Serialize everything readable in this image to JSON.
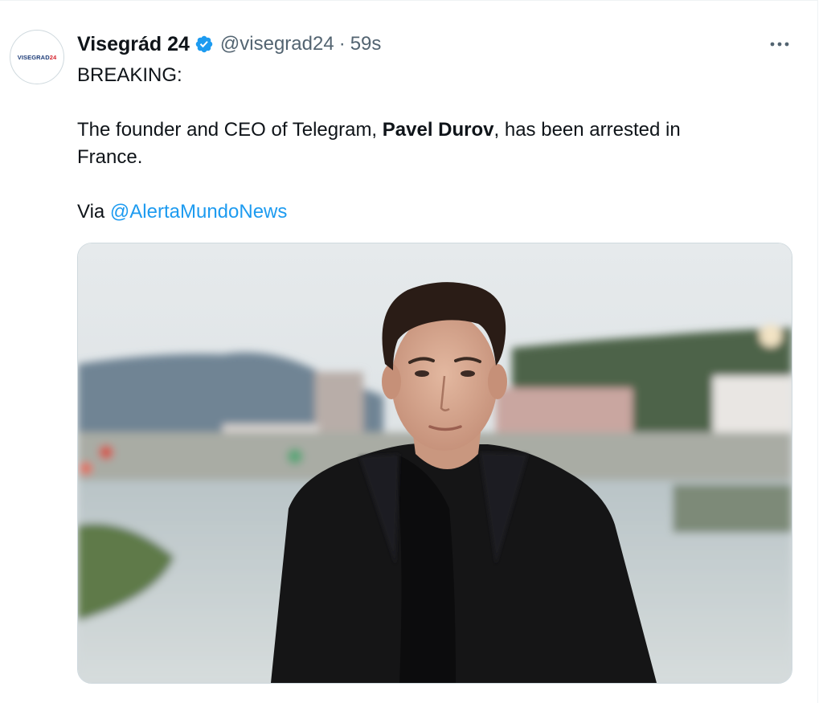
{
  "tweet": {
    "display_name": "Visegrád 24",
    "handle": "@visegrad24",
    "separator": "·",
    "time": "59s",
    "avatar_logo": {
      "main": "VISEGRAD",
      "accent": "24"
    },
    "text": {
      "line1": "BREAKING:",
      "line2_pre": "The founder and CEO of Telegram, ",
      "line2_bold": "Pavel Durov",
      "line2_post": ", has been arrested in",
      "line3": "France.",
      "via_label": "Via ",
      "via_mention": "@AlertaMundoNews"
    },
    "more_icon": "more-horizontal-icon",
    "verified_icon": "verified-badge-icon"
  },
  "colors": {
    "text": "#0f1419",
    "secondary": "#536471",
    "link": "#1d9bf0",
    "verified": "#1d9bf0",
    "border": "#cfd9de"
  }
}
